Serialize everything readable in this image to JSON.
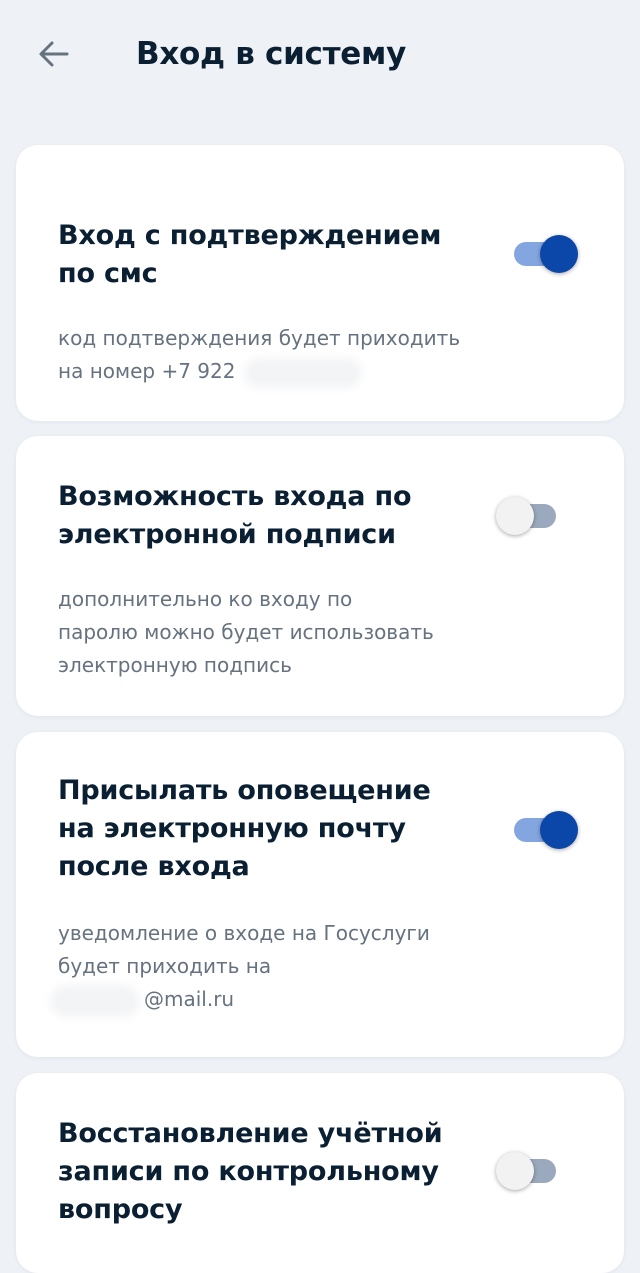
{
  "header": {
    "title": "Вход в систему"
  },
  "cards": [
    {
      "title_line1": "Вход с подтверждением",
      "title_line2": "по смс",
      "desc_line1": "код подтверждения будет приходить",
      "desc_line2": "на номер +7 922",
      "toggle_on": true
    },
    {
      "title_line1": "Возможность входа по",
      "title_line2": "электронной подписи",
      "desc_line1": "дополнительно ко входу по",
      "desc_line2": "паролю можно будет использовать",
      "desc_line3": "электронную подпись",
      "toggle_on": false
    },
    {
      "title_line1": "Присылать оповещение",
      "title_line2": "на электронную почту",
      "title_line3": "после входа",
      "desc_line1": "уведомление о входе на Госуслуги",
      "desc_line2": "будет приходить на",
      "desc_line3": "@mail.ru",
      "toggle_on": true
    },
    {
      "title_line1": "Восстановление учётной",
      "title_line2": "записи по контрольному",
      "title_line3": "вопросу",
      "toggle_on": false
    }
  ],
  "colors": {
    "accent": "#0b47a8",
    "track_on": "#84a6e0",
    "track_off": "#9aa9bd",
    "background": "#eef1f6"
  }
}
